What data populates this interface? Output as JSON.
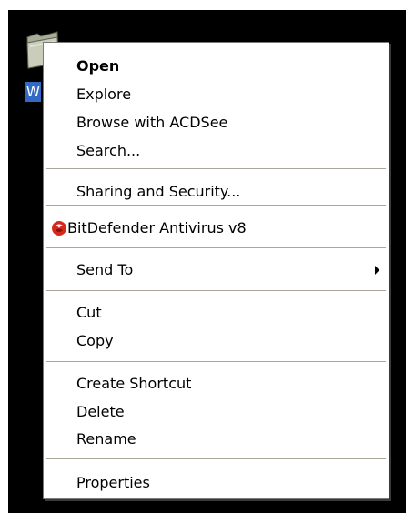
{
  "desktop": {
    "folder_label": "W"
  },
  "menu": {
    "items": [
      {
        "label": "Open",
        "bold": true
      },
      {
        "label": "Explore"
      },
      {
        "label": "Browse with ACDSee"
      },
      {
        "label": "Search..."
      },
      {
        "label": "Sharing and Security..."
      },
      {
        "label": "BitDefender Antivirus v8",
        "icon": "bitdefender-icon"
      },
      {
        "label": "Send To",
        "submenu": true
      },
      {
        "label": "Cut"
      },
      {
        "label": "Copy"
      },
      {
        "label": "Create Shortcut"
      },
      {
        "label": "Delete"
      },
      {
        "label": "Rename"
      },
      {
        "label": "Properties"
      }
    ]
  },
  "colors": {
    "desktop_background": "#000000",
    "selection": "#316ac5",
    "separator": "#aca899",
    "bitdefender_red": "#d42a1e"
  }
}
